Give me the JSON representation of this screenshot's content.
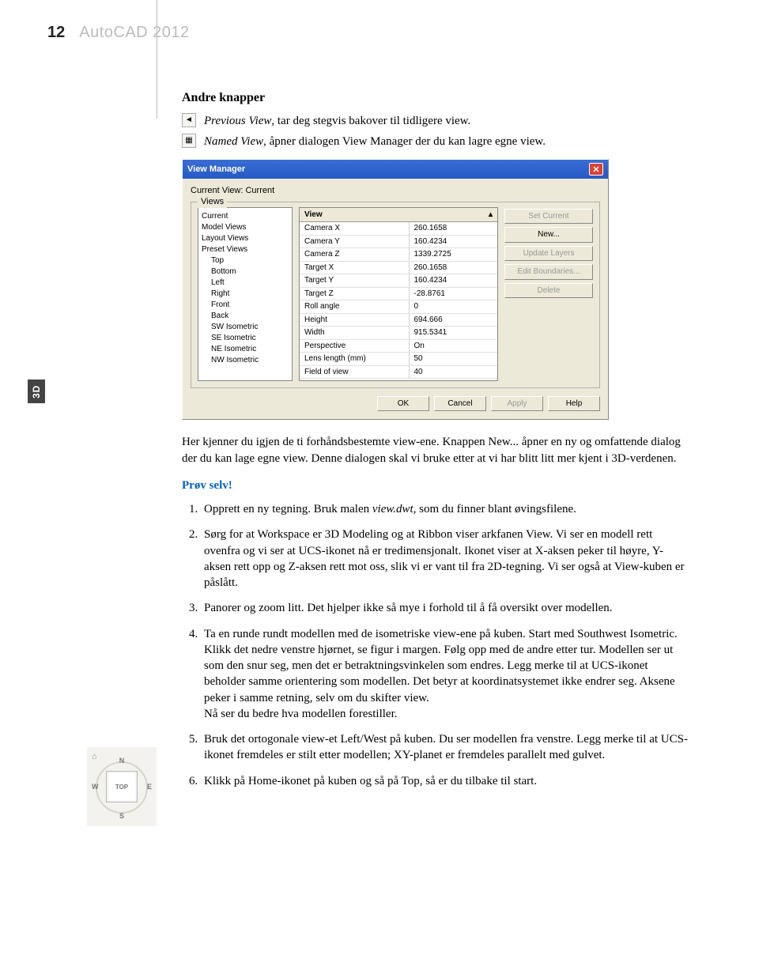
{
  "header": {
    "page_number": "12",
    "book_title": "AutoCAD 2012"
  },
  "sidetab": "3D",
  "section": {
    "heading": "Andre knapper",
    "prev_view_label": "Previous View",
    "prev_view_text": ", tar deg stegvis bakover til tidligere view.",
    "named_view_label": "Named View",
    "named_view_text": ", åpner dialogen View Manager der du kan lagre egne view."
  },
  "view_manager": {
    "title": "View Manager",
    "current_label": "Current View: Current",
    "views_legend": "Views",
    "tree": [
      {
        "label": "Current",
        "indent": 0
      },
      {
        "label": "Model Views",
        "indent": 0
      },
      {
        "label": "Layout Views",
        "indent": 0
      },
      {
        "label": "Preset Views",
        "indent": 0
      },
      {
        "label": "Top",
        "indent": 1
      },
      {
        "label": "Bottom",
        "indent": 1
      },
      {
        "label": "Left",
        "indent": 1
      },
      {
        "label": "Right",
        "indent": 1
      },
      {
        "label": "Front",
        "indent": 1
      },
      {
        "label": "Back",
        "indent": 1
      },
      {
        "label": "SW Isometric",
        "indent": 1
      },
      {
        "label": "SE Isometric",
        "indent": 1
      },
      {
        "label": "NE Isometric",
        "indent": 1
      },
      {
        "label": "NW Isometric",
        "indent": 1
      }
    ],
    "grid_head": "View",
    "grid": [
      {
        "k": "Camera X",
        "v": "260.1658"
      },
      {
        "k": "Camera Y",
        "v": "160.4234"
      },
      {
        "k": "Camera Z",
        "v": "1339.2725"
      },
      {
        "k": "Target X",
        "v": "260.1658"
      },
      {
        "k": "Target Y",
        "v": "160.4234"
      },
      {
        "k": "Target Z",
        "v": "-28.8761"
      },
      {
        "k": "Roll angle",
        "v": "0"
      },
      {
        "k": "Height",
        "v": "694.666"
      },
      {
        "k": "Width",
        "v": "915.5341"
      },
      {
        "k": "Perspective",
        "v": "On"
      },
      {
        "k": "Lens length (mm)",
        "v": "50"
      },
      {
        "k": "Field of view",
        "v": "40"
      }
    ],
    "side_buttons": {
      "set_current": "Set Current",
      "new": "New...",
      "update_layers": "Update Layers",
      "edit_boundaries": "Edit Boundaries...",
      "delete": "Delete"
    },
    "actions": {
      "ok": "OK",
      "cancel": "Cancel",
      "apply": "Apply",
      "help": "Help"
    }
  },
  "after_dialog": "Her kjenner du igjen de ti forhåndsbestemte view-ene. Knappen New... åpner en ny og omfattende dialog der du kan lage egne view. Denne dialogen skal vi bruke etter at vi har blitt litt mer kjent i 3D-verdenen.",
  "try_self_label": "Prøv selv!",
  "steps": {
    "s1a": "Opprett en ny tegning. Bruk malen ",
    "s1_em": "view.dwt",
    "s1b": ", som du finner blant øvingsfilene.",
    "s2": "Sørg for at Workspace er 3D Modeling og at Ribbon viser arkfanen View. Vi ser en modell rett ovenfra og vi ser at UCS-ikonet nå er tredimensjonalt. Ikonet viser at X-aksen peker til høyre, Y-aksen rett opp og Z-aksen rett mot oss, slik vi er vant til fra 2D-tegning. Vi ser også at View-kuben er påslått.",
    "s3": "Panorer og zoom litt. Det hjelper ikke så mye i forhold til å få oversikt over modellen.",
    "s4a": "Ta en runde rundt modellen med de isometriske view-ene på kuben. Start med Southwest Isometric. Klikk det nedre venstre hjørnet, se figur i margen. Følg opp med de andre etter tur. Modellen ser ut som den snur seg, men det er betraktningsvinkelen som endres. Legg merke til at UCS-ikonet beholder samme orientering som modellen. Det betyr at koordinatsystemet ikke endrer seg. Aksene peker i samme retning, selv om du skifter view.",
    "s4b": "Nå ser du bedre hva modellen forestiller.",
    "s5": "Bruk det ortogonale view-et Left/West på kuben. Du ser modellen fra venstre. Legg merke til at UCS-ikonet fremdeles er stilt etter modellen; XY-planet er fremdeles parallelt med gulvet.",
    "s6": "Klikk på Home-ikonet på kuben og så på Top, så er du tilbake til start."
  },
  "cube": {
    "top": "TOP",
    "n": "N",
    "s": "S",
    "w": "W",
    "e": "E"
  }
}
